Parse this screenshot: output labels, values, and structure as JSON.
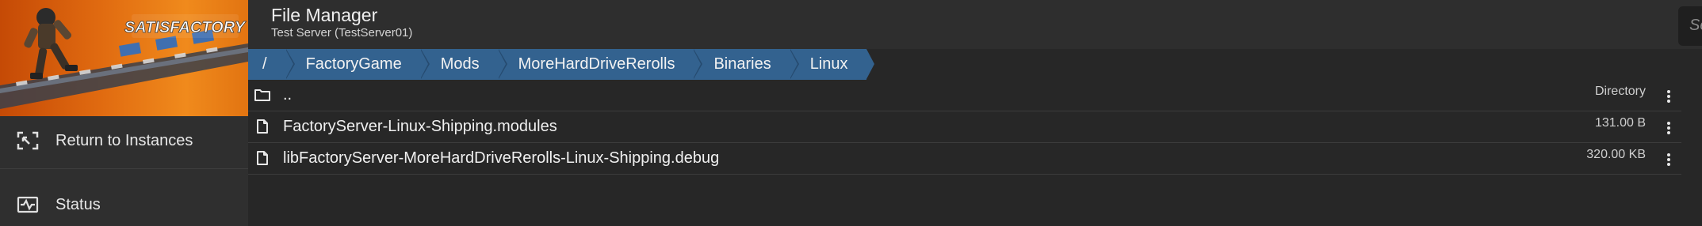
{
  "sidebar": {
    "logo_text": "SATISFACTORY",
    "items": [
      {
        "label": "Return to Instances",
        "icon": "return-to-instances-icon"
      },
      {
        "label": "Status",
        "icon": "status-icon"
      }
    ]
  },
  "header": {
    "title": "File Manager",
    "subtitle": "Test Server (TestServer01)"
  },
  "search": {
    "placeholder": "Search"
  },
  "breadcrumb": [
    {
      "label": "/"
    },
    {
      "label": "FactoryGame"
    },
    {
      "label": "Mods"
    },
    {
      "label": "MoreHardDriveRerolls"
    },
    {
      "label": "Binaries"
    },
    {
      "label": "Linux"
    }
  ],
  "files": [
    {
      "name": "..",
      "size": "Directory",
      "icon": "folder-icon"
    },
    {
      "name": "FactoryServer-Linux-Shipping.modules",
      "size": "131.00 B",
      "icon": "file-icon"
    },
    {
      "name": "libFactoryServer-MoreHardDriveRerolls-Linux-Shipping.debug",
      "size": "320.00 KB",
      "icon": "file-icon"
    }
  ],
  "colors": {
    "breadcrumb_bg": "#33628f",
    "banner_accent": "#e06a10",
    "background": "#272727"
  }
}
